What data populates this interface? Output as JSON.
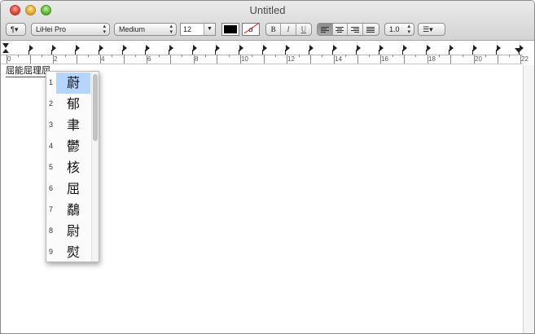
{
  "window": {
    "title": "Untitled"
  },
  "toolbar": {
    "styles_label": "¶▾",
    "font_family": "LiHei Pro",
    "font_typeface": "Medium",
    "font_size": "12",
    "bold_label": "B",
    "italic_label": "I",
    "underline_label": "U",
    "line_spacing": "1.0",
    "list_label": "☰▾",
    "text_color": "#000000",
    "highlight_glyph": "a"
  },
  "ruler": {
    "numbers": [
      "0",
      "2",
      "4",
      "6",
      "8",
      "10",
      "12",
      "14",
      "16",
      "18",
      "20",
      "22"
    ]
  },
  "document": {
    "text": "屈能屈理屈"
  },
  "candidates": {
    "selected_index": 0,
    "items": [
      {
        "num": "1",
        "char": "蔚"
      },
      {
        "num": "2",
        "char": "郁"
      },
      {
        "num": "3",
        "char": "聿"
      },
      {
        "num": "4",
        "char": "鬱"
      },
      {
        "num": "5",
        "char": "核"
      },
      {
        "num": "6",
        "char": "屈"
      },
      {
        "num": "7",
        "char": "鷸"
      },
      {
        "num": "8",
        "char": "尉"
      },
      {
        "num": "9",
        "char": "熨"
      }
    ]
  }
}
